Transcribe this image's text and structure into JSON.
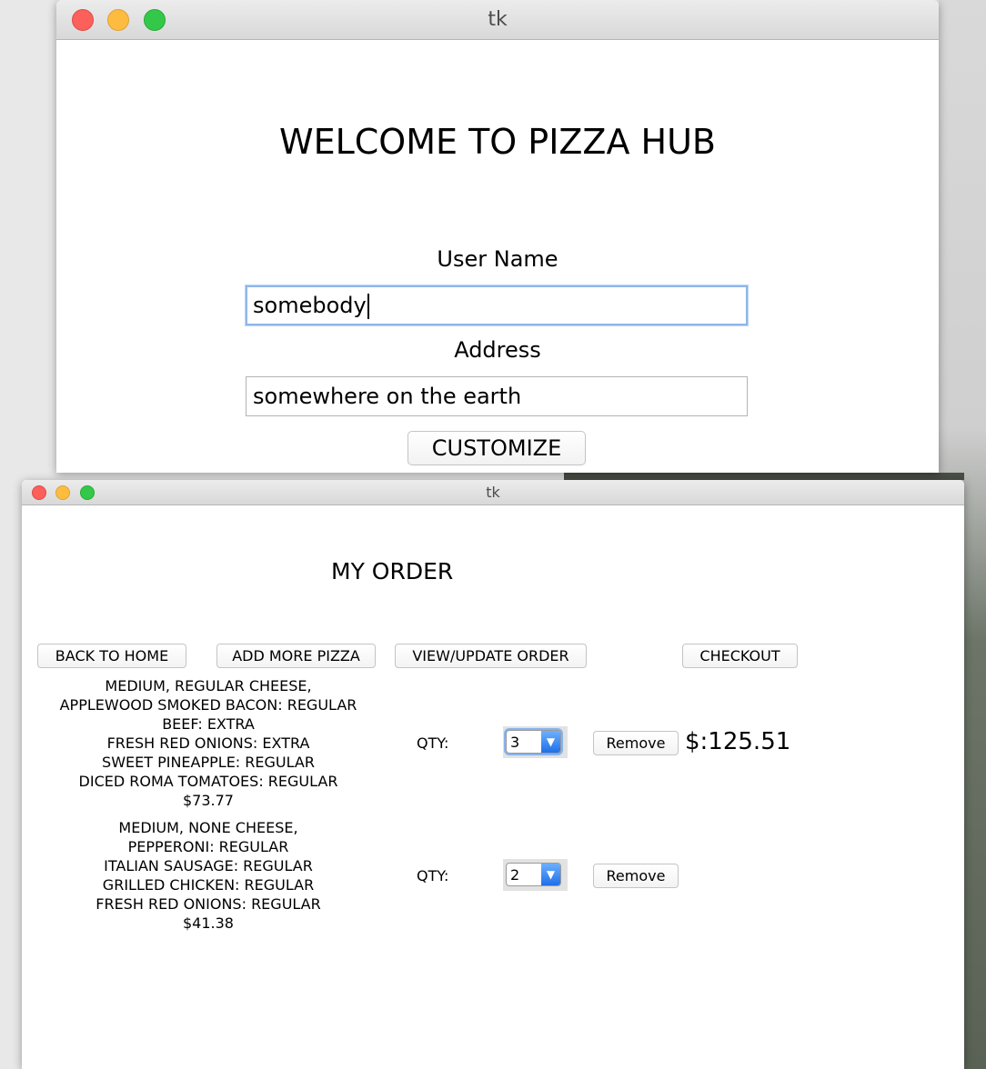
{
  "window_login": {
    "title": "tk",
    "heading": "WELCOME TO PIZZA HUB",
    "username_label": "User Name",
    "username_value": "somebody",
    "address_label": "Address",
    "address_value": "somewhere on the earth",
    "customize_label": "CUSTOMIZE"
  },
  "window_order": {
    "title": "tk",
    "heading": "MY ORDER",
    "nav": {
      "back_home": "BACK TO HOME",
      "add_more": "ADD MORE PIZZA",
      "view_update": "VIEW/UPDATE ORDER",
      "checkout": "CHECKOUT"
    },
    "items": [
      {
        "lines": [
          "MEDIUM, REGULAR CHEESE,",
          "APPLEWOOD SMOKED BACON: REGULAR",
          "BEEF: EXTRA",
          "FRESH RED ONIONS: EXTRA",
          "SWEET PINEAPPLE: REGULAR",
          "DICED ROMA TOMATOES: REGULAR",
          "$73.77"
        ],
        "qty_label": "QTY:",
        "qty": "3",
        "remove_label": "Remove"
      },
      {
        "lines": [
          "MEDIUM, NONE CHEESE,",
          "PEPPERONI: REGULAR",
          "ITALIAN SAUSAGE: REGULAR",
          "GRILLED CHICKEN: REGULAR",
          "FRESH RED ONIONS: REGULAR",
          "$41.38"
        ],
        "qty_label": "QTY:",
        "qty": "2",
        "remove_label": "Remove"
      }
    ],
    "total": "$:125.51"
  }
}
